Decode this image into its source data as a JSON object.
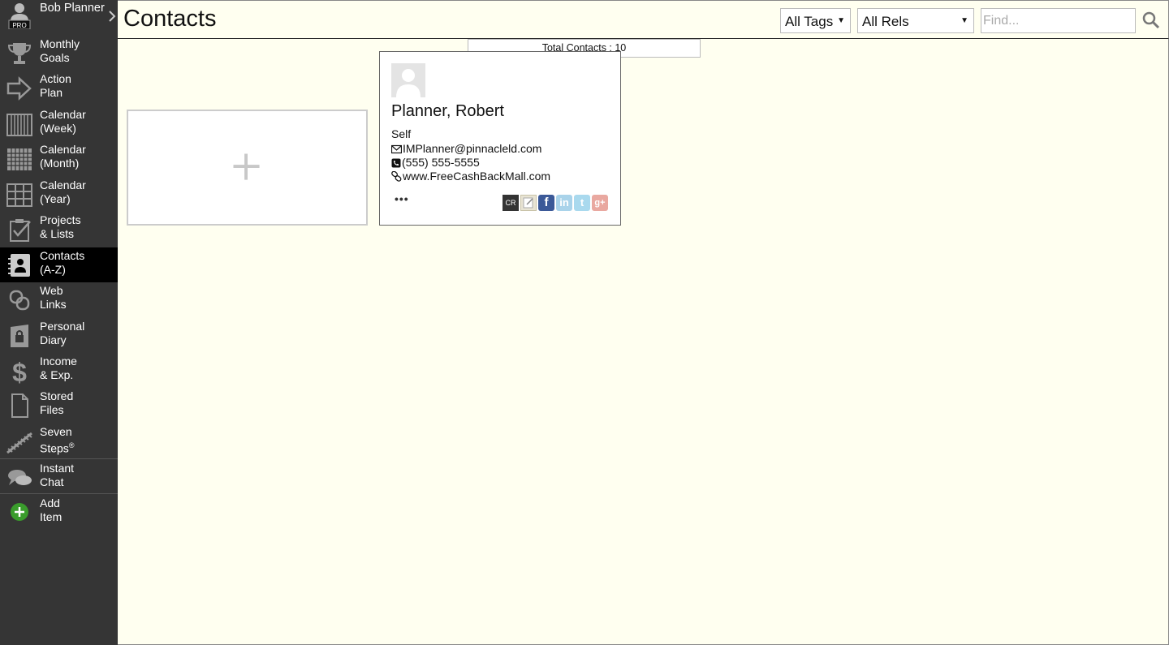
{
  "user": {
    "name": "Bob Planner",
    "badge": "PRO"
  },
  "sidebar": {
    "items": [
      {
        "label": "Monthly\nGoals",
        "icon": "trophy-icon"
      },
      {
        "label": "Action\nPlan",
        "icon": "arrow-right-icon"
      },
      {
        "label": "Calendar\n(Week)",
        "icon": "calendar-week-icon"
      },
      {
        "label": "Calendar\n(Month)",
        "icon": "calendar-month-icon"
      },
      {
        "label": "Calendar\n(Year)",
        "icon": "calendar-year-icon"
      },
      {
        "label": "Projects\n& Lists",
        "icon": "clipboard-check-icon"
      },
      {
        "label": "Contacts\n(A-Z)",
        "icon": "contacts-book-icon",
        "active": true
      },
      {
        "label": "Web\nLinks",
        "icon": "link-icon"
      },
      {
        "label": "Personal\nDiary",
        "icon": "lock-diary-icon"
      },
      {
        "label": "Income\n& Exp.",
        "icon": "dollar-icon"
      },
      {
        "label": "Stored\nFiles",
        "icon": "file-icon"
      },
      {
        "label": "Seven\nSteps",
        "superscript": "®",
        "icon": "stairs-icon"
      },
      {
        "label": "Instant\nChat",
        "icon": "chat-bubbles-icon"
      },
      {
        "label": "Add\nItem",
        "icon": "add-circle-icon"
      }
    ]
  },
  "header": {
    "title": "Contacts",
    "tags_filter": "All Tags",
    "rels_filter": "All Rels",
    "find_placeholder": "Find..."
  },
  "main": {
    "total_contacts": "Total Contacts : 10",
    "add_label": "+",
    "contacts": [
      {
        "name": "Planner, Robert",
        "relationship": "Self",
        "email": "IMPlanner@pinnacleld.com",
        "phone": "(555) 555-5555",
        "website": "www.FreeCashBackMall.com",
        "more": "•••",
        "actions": [
          "CR",
          "edit-icon",
          "facebook-icon",
          "linkedin-icon",
          "twitter-icon",
          "google-plus-icon"
        ]
      }
    ]
  },
  "colors": {
    "sidebar_bg": "#353535",
    "active_bg": "#000000",
    "page_bg": "#fffff0",
    "add_green": "#3a9c2c"
  }
}
